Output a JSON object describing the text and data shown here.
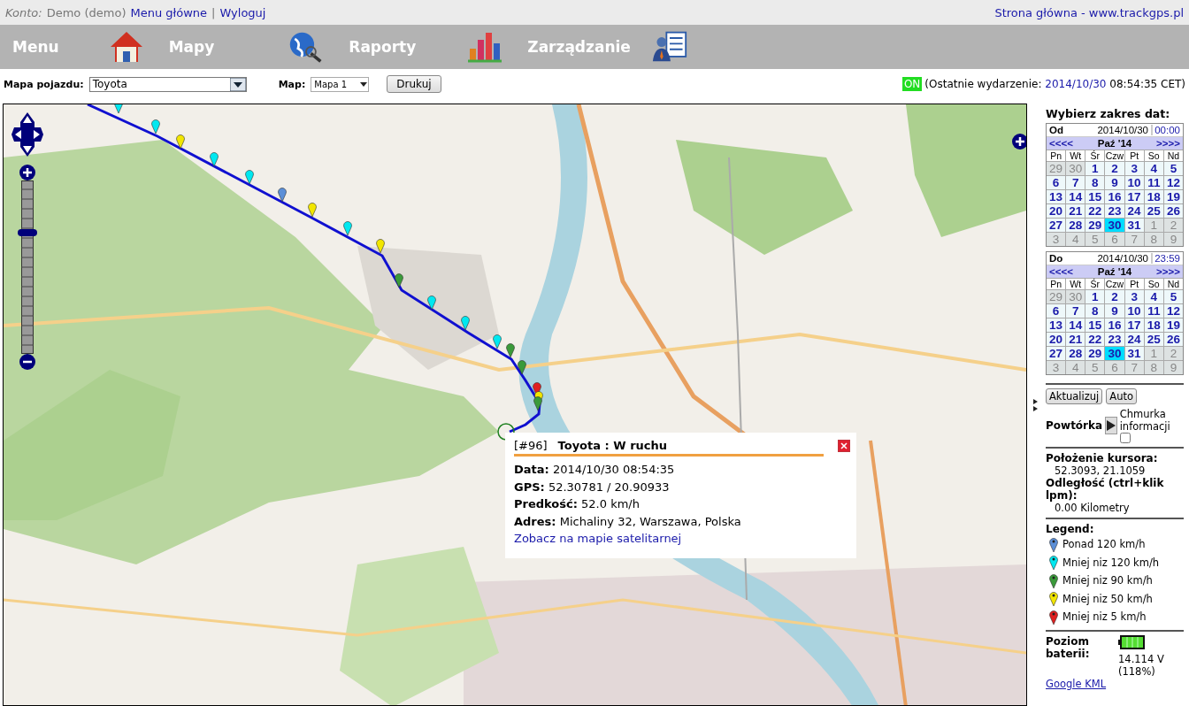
{
  "account": {
    "label": "Konto:",
    "user": "Demo (demo)",
    "links": [
      "Menu główne",
      "Wyloguj"
    ],
    "separator": "|",
    "home_link": "Strona główna - www.trackgps.pl"
  },
  "nav": [
    {
      "label": "Menu"
    },
    {
      "label": "Mapy"
    },
    {
      "label": "Raporty"
    },
    {
      "label": "Zarządzanie"
    }
  ],
  "toolbar": {
    "vehicle_label": "Mapa pojazdu:",
    "vehicle": "Toyota",
    "map_label": "Map:",
    "map": "Mapa 1",
    "print": "Drukuj",
    "status": "ON",
    "status_on": true,
    "last_event_label": "(Ostatnie wydarzenie:",
    "last_event_date": "2014/10/30",
    "last_event_time": "08:54:35 CET)"
  },
  "zoom": {
    "level": 0.71
  },
  "popup": {
    "id": "[#96]",
    "title": "Toyota : W ruchu",
    "rows": [
      {
        "label": "Data:",
        "value": "2014/10/30 08:54:35"
      },
      {
        "label": "GPS:",
        "value": "52.30781 / 20.90933"
      },
      {
        "label": "Predkość:",
        "value": "52.0 km/h"
      },
      {
        "label": "Adres:",
        "value": "Michaliny 32, Warszawa, Polska"
      }
    ],
    "link": "Zobacz na mapie satelitarnej"
  },
  "sidebar": {
    "title": "Wybierz zakres dat:",
    "calendars": [
      {
        "label": "Od",
        "date": "2014/10/30",
        "time": "00:00",
        "prev": "<<<<",
        "month": "Paź '14",
        "next": ">>>>",
        "weekdays": [
          "Pn",
          "Wt",
          "Śr",
          "Czw",
          "Pt",
          "So",
          "Nd"
        ],
        "days": [
          {
            "label": "29",
            "muted": true,
            "selected": false
          },
          {
            "label": "30",
            "muted": true,
            "selected": false
          },
          {
            "label": "1",
            "muted": false,
            "selected": false
          },
          {
            "label": "2",
            "muted": false,
            "selected": false
          },
          {
            "label": "3",
            "muted": false,
            "selected": false
          },
          {
            "label": "4",
            "muted": false,
            "selected": false
          },
          {
            "label": "5",
            "muted": false,
            "selected": false
          },
          {
            "label": "6",
            "muted": false,
            "selected": false
          },
          {
            "label": "7",
            "muted": false,
            "selected": false
          },
          {
            "label": "8",
            "muted": false,
            "selected": false
          },
          {
            "label": "9",
            "muted": false,
            "selected": false
          },
          {
            "label": "10",
            "muted": false,
            "selected": false
          },
          {
            "label": "11",
            "muted": false,
            "selected": false
          },
          {
            "label": "12",
            "muted": false,
            "selected": false
          },
          {
            "label": "13",
            "muted": false,
            "selected": false
          },
          {
            "label": "14",
            "muted": false,
            "selected": false
          },
          {
            "label": "15",
            "muted": false,
            "selected": false
          },
          {
            "label": "16",
            "muted": false,
            "selected": false
          },
          {
            "label": "17",
            "muted": false,
            "selected": false
          },
          {
            "label": "18",
            "muted": false,
            "selected": false
          },
          {
            "label": "19",
            "muted": false,
            "selected": false
          },
          {
            "label": "20",
            "muted": false,
            "selected": false
          },
          {
            "label": "21",
            "muted": false,
            "selected": false
          },
          {
            "label": "22",
            "muted": false,
            "selected": false
          },
          {
            "label": "23",
            "muted": false,
            "selected": false
          },
          {
            "label": "24",
            "muted": false,
            "selected": false
          },
          {
            "label": "25",
            "muted": false,
            "selected": false
          },
          {
            "label": "26",
            "muted": false,
            "selected": false
          },
          {
            "label": "27",
            "muted": false,
            "selected": false
          },
          {
            "label": "28",
            "muted": false,
            "selected": false
          },
          {
            "label": "29",
            "muted": false,
            "selected": false
          },
          {
            "label": "30",
            "muted": false,
            "selected": true
          },
          {
            "label": "31",
            "muted": false,
            "selected": false
          },
          {
            "label": "1",
            "muted": true,
            "selected": false
          },
          {
            "label": "2",
            "muted": true,
            "selected": false
          },
          {
            "label": "3",
            "muted": true,
            "selected": false
          },
          {
            "label": "4",
            "muted": true,
            "selected": false
          },
          {
            "label": "5",
            "muted": true,
            "selected": false
          },
          {
            "label": "6",
            "muted": true,
            "selected": false
          },
          {
            "label": "7",
            "muted": true,
            "selected": false
          },
          {
            "label": "8",
            "muted": true,
            "selected": false
          },
          {
            "label": "9",
            "muted": true,
            "selected": false
          }
        ]
      },
      {
        "label": "Do",
        "date": "2014/10/30",
        "time": "23:59",
        "prev": "<<<<",
        "month": "Paź '14",
        "next": ">>>>",
        "weekdays": [
          "Pn",
          "Wt",
          "Śr",
          "Czw",
          "Pt",
          "So",
          "Nd"
        ],
        "days": [
          {
            "label": "29",
            "muted": true,
            "selected": false
          },
          {
            "label": "30",
            "muted": true,
            "selected": false
          },
          {
            "label": "1",
            "muted": false,
            "selected": false
          },
          {
            "label": "2",
            "muted": false,
            "selected": false
          },
          {
            "label": "3",
            "muted": false,
            "selected": false
          },
          {
            "label": "4",
            "muted": false,
            "selected": false
          },
          {
            "label": "5",
            "muted": false,
            "selected": false
          },
          {
            "label": "6",
            "muted": false,
            "selected": false
          },
          {
            "label": "7",
            "muted": false,
            "selected": false
          },
          {
            "label": "8",
            "muted": false,
            "selected": false
          },
          {
            "label": "9",
            "muted": false,
            "selected": false
          },
          {
            "label": "10",
            "muted": false,
            "selected": false
          },
          {
            "label": "11",
            "muted": false,
            "selected": false
          },
          {
            "label": "12",
            "muted": false,
            "selected": false
          },
          {
            "label": "13",
            "muted": false,
            "selected": false
          },
          {
            "label": "14",
            "muted": false,
            "selected": false
          },
          {
            "label": "15",
            "muted": false,
            "selected": false
          },
          {
            "label": "16",
            "muted": false,
            "selected": false
          },
          {
            "label": "17",
            "muted": false,
            "selected": false
          },
          {
            "label": "18",
            "muted": false,
            "selected": false
          },
          {
            "label": "19",
            "muted": false,
            "selected": false
          },
          {
            "label": "20",
            "muted": false,
            "selected": false
          },
          {
            "label": "21",
            "muted": false,
            "selected": false
          },
          {
            "label": "22",
            "muted": false,
            "selected": false
          },
          {
            "label": "23",
            "muted": false,
            "selected": false
          },
          {
            "label": "24",
            "muted": false,
            "selected": false
          },
          {
            "label": "25",
            "muted": false,
            "selected": false
          },
          {
            "label": "26",
            "muted": false,
            "selected": false
          },
          {
            "label": "27",
            "muted": false,
            "selected": false
          },
          {
            "label": "28",
            "muted": false,
            "selected": false
          },
          {
            "label": "29",
            "muted": false,
            "selected": false
          },
          {
            "label": "30",
            "muted": false,
            "selected": true
          },
          {
            "label": "31",
            "muted": false,
            "selected": false
          },
          {
            "label": "1",
            "muted": true,
            "selected": false
          },
          {
            "label": "2",
            "muted": true,
            "selected": false
          },
          {
            "label": "3",
            "muted": true,
            "selected": false
          },
          {
            "label": "4",
            "muted": true,
            "selected": false
          },
          {
            "label": "5",
            "muted": true,
            "selected": false
          },
          {
            "label": "6",
            "muted": true,
            "selected": false
          },
          {
            "label": "7",
            "muted": true,
            "selected": false
          },
          {
            "label": "8",
            "muted": true,
            "selected": false
          },
          {
            "label": "9",
            "muted": true,
            "selected": false
          }
        ]
      }
    ],
    "buttons": [
      "Aktualizuj",
      "Auto"
    ],
    "replay_label": "Powtórka",
    "tooltip_label": "Chmurka informacji",
    "tooltip_checked": false,
    "cursor_label": "Położenie kursora:",
    "cursor_value": "52.3093, 21.1059",
    "distance_label": "Odległość (ctrl+klik lpm):",
    "distance_value": "0.00 Kilometry",
    "legend_title": "Legend:",
    "legend": [
      {
        "label": "Ponad 120 km/h",
        "color": "#5b8fd8"
      },
      {
        "label": "Mniej niz 120 km/h",
        "color": "#00e8f0"
      },
      {
        "label": "Mniej niz 90 km/h",
        "color": "#3a9a3a"
      },
      {
        "label": "Mniej niz 50 km/h",
        "color": "#f2e600"
      },
      {
        "label": "Mniej niz 5 km/h",
        "color": "#e02020"
      }
    ],
    "battery_label": "Poziom baterii:",
    "battery_voltage": "14.114 V",
    "battery_percent": "(118%)",
    "kml_link": "Google KML"
  }
}
